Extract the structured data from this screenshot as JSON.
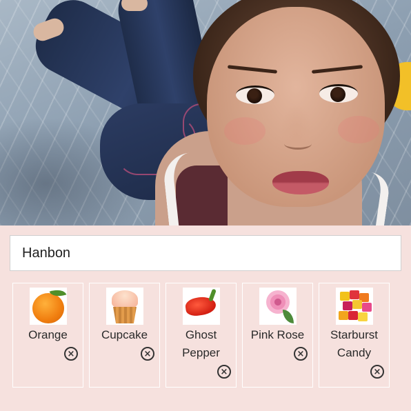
{
  "name_input": {
    "value": "Hanbon",
    "placeholder": ""
  },
  "items": [
    {
      "label": "Orange",
      "icon": "orange-thumbnail"
    },
    {
      "label": "Cupcake",
      "icon": "cupcake-thumbnail"
    },
    {
      "label": "Ghost Pepper",
      "icon": "ghost-pepper-thumbnail"
    },
    {
      "label": "Pink Rose",
      "icon": "pink-rose-thumbnail"
    },
    {
      "label": "Starburst Candy",
      "icon": "starburst-candy-thumbnail"
    }
  ],
  "remove_symbol": "×",
  "colors": {
    "background": "#f6e1de",
    "card_border": "#ffffff",
    "text": "#2a2a2a"
  }
}
